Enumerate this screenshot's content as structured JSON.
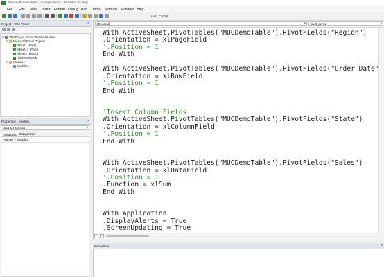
{
  "window": {
    "title": "Microsoft Visual Basic for Applications - [Module1 (Code)]"
  },
  "menu": [
    "File",
    "Edit",
    "View",
    "Insert",
    "Format",
    "Debug",
    "Run",
    "Tools",
    "Add-Ins",
    "Window",
    "Help"
  ],
  "toolbar": {
    "cursor_position": "Ln 6, Col 26"
  },
  "project_panel": {
    "title": "Project - VBAProject",
    "close": "×",
    "tree": [
      {
        "label": "VBAProject (Pivot Workbook.xlsm)",
        "icon": "vba-project-icon",
        "level": 0,
        "expander": "⊟"
      },
      {
        "label": "Microsoft Excel Objects",
        "icon": "folder-icon",
        "level": 1,
        "expander": "⊟"
      },
      {
        "label": "Sheet1 (Data)",
        "icon": "sheet-icon",
        "level": 2,
        "expander": ""
      },
      {
        "label": "Sheet17 (Pivot)",
        "icon": "sheet-icon",
        "level": 2,
        "expander": ""
      },
      {
        "label": "Sheet2 (Macro)",
        "icon": "sheet-icon",
        "level": 2,
        "expander": ""
      },
      {
        "label": "ThisWorkbook",
        "icon": "sheet-icon",
        "level": 2,
        "expander": ""
      },
      {
        "label": "Modules",
        "icon": "folder-icon",
        "level": 1,
        "expander": "⊟"
      },
      {
        "label": "Module1",
        "icon": "module-icon",
        "level": 2,
        "expander": ""
      }
    ]
  },
  "properties_panel": {
    "title": "Properties - Module1",
    "close": "×",
    "object_select": "Module1  Module",
    "tabs": [
      "Alphabetic",
      "Categorized"
    ],
    "rows": [
      {
        "key": "(Name)",
        "value": "Module1"
      }
    ]
  },
  "code_window": {
    "object_combo": "(General)",
    "procedure_combo": "pivot_demo",
    "lines": [
      {
        "text": "With ActiveSheet.PivotTables(\"MUODemoTable\").PivotFields(\"Region\")",
        "type": "code"
      },
      {
        "text": ".Orientation = xlPageField",
        "type": "code"
      },
      {
        "text": "'.Position = 1",
        "type": "comment"
      },
      {
        "text": "End With",
        "type": "code"
      },
      {
        "text": "",
        "type": "code"
      },
      {
        "text": "With ActiveSheet.PivotTables(\"MUODemoTable\").PivotFields(\"Order Date\")",
        "type": "code"
      },
      {
        "text": ".Orientation = xlRowField",
        "type": "code"
      },
      {
        "text": "'.Position = 1",
        "type": "comment"
      },
      {
        "text": "End With",
        "type": "code"
      },
      {
        "text": "",
        "type": "code"
      },
      {
        "text": "",
        "type": "code"
      },
      {
        "text": "'Insert Column Fields",
        "type": "comment"
      },
      {
        "text": "With ActiveSheet.PivotTables(\"MUODemoTable\").PivotFields(\"State\")",
        "type": "code"
      },
      {
        "text": ".Orientation = xlColumnField",
        "type": "code"
      },
      {
        "text": "'.Position = 1",
        "type": "comment"
      },
      {
        "text": "End With",
        "type": "code"
      },
      {
        "text": "",
        "type": "code"
      },
      {
        "text": "",
        "type": "code"
      },
      {
        "text": "With ActiveSheet.PivotTables(\"MUODemoTable\").PivotFields(\"Sales\")",
        "type": "code"
      },
      {
        "text": ".Orientation = xlDataField",
        "type": "code"
      },
      {
        "text": "'.Position = 1",
        "type": "comment"
      },
      {
        "text": ".Function = xlSum",
        "type": "code"
      },
      {
        "text": "End With",
        "type": "code"
      },
      {
        "text": "",
        "type": "code"
      },
      {
        "text": "",
        "type": "code"
      },
      {
        "text": "With Application",
        "type": "code"
      },
      {
        "text": ".DisplayAlerts = True",
        "type": "code"
      },
      {
        "text": ".ScreenUpdating = True",
        "type": "code"
      }
    ]
  },
  "immediate_panel": {
    "title": "Immediate",
    "close": "×"
  }
}
